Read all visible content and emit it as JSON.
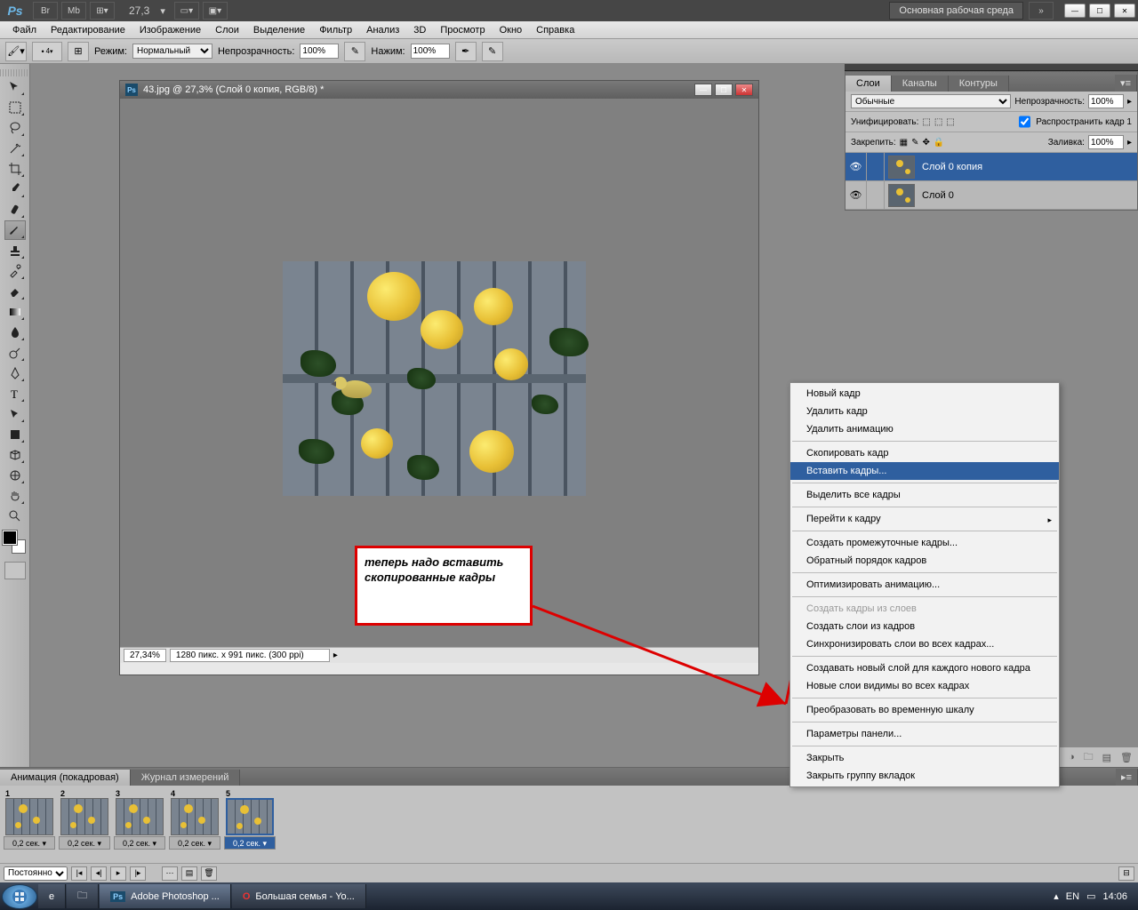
{
  "titlebar": {
    "zoom": "27,3",
    "workspace": "Основная рабочая среда"
  },
  "menu": [
    "Файл",
    "Редактирование",
    "Изображение",
    "Слои",
    "Выделение",
    "Фильтр",
    "Анализ",
    "3D",
    "Просмотр",
    "Окно",
    "Справка"
  ],
  "options": {
    "brush_size": "4",
    "mode_label": "Режим:",
    "mode": "Нормальный",
    "opacity_label": "Непрозрачность:",
    "opacity": "100%",
    "flow_label": "Нажим:",
    "flow": "100%"
  },
  "doc": {
    "title": "43.jpg @ 27,3% (Слой 0 копия, RGB/8) *",
    "status_zoom": "27,34%",
    "status_dims": "1280 пикс. x 991 пикс. (300 ppi)"
  },
  "annotation": "теперь надо вставить скопированные кадры",
  "layers_panel": {
    "tabs": [
      "Слои",
      "Каналы",
      "Контуры"
    ],
    "blend": "Обычные",
    "opacity_label": "Непрозрачность:",
    "opacity": "100%",
    "unify_label": "Унифицировать:",
    "propagate_label": "Распространить кадр 1",
    "lock_label": "Закрепить:",
    "fill_label": "Заливка:",
    "fill": "100%",
    "layers": [
      {
        "name": "Слой 0 копия",
        "sel": true
      },
      {
        "name": "Слой 0",
        "sel": false
      }
    ]
  },
  "context_menu": [
    {
      "t": "Новый кадр"
    },
    {
      "t": "Удалить кадр"
    },
    {
      "t": "Удалить анимацию"
    },
    {
      "sep": true
    },
    {
      "t": "Скопировать кадр"
    },
    {
      "t": "Вставить кадры...",
      "hl": true
    },
    {
      "sep": true
    },
    {
      "t": "Выделить все кадры"
    },
    {
      "sep": true
    },
    {
      "t": "Перейти к кадру",
      "arrow": true
    },
    {
      "sep": true
    },
    {
      "t": "Создать промежуточные кадры..."
    },
    {
      "t": "Обратный порядок кадров"
    },
    {
      "sep": true
    },
    {
      "t": "Оптимизировать анимацию..."
    },
    {
      "sep": true
    },
    {
      "t": "Создать кадры из слоев",
      "disabled": true
    },
    {
      "t": "Создать слои из кадров"
    },
    {
      "t": "Синхронизировать слои во всех кадрах..."
    },
    {
      "sep": true
    },
    {
      "t": "Создавать новый слой для каждого нового кадра"
    },
    {
      "t": "Новые слои видимы во всех кадрах"
    },
    {
      "sep": true
    },
    {
      "t": "Преобразовать во временную шкалу"
    },
    {
      "sep": true
    },
    {
      "t": "Параметры панели..."
    },
    {
      "sep": true
    },
    {
      "t": "Закрыть"
    },
    {
      "t": "Закрыть группу вкладок"
    }
  ],
  "anim": {
    "tabs": [
      "Анимация (покадровая)",
      "Журнал измерений"
    ],
    "frames": [
      {
        "n": "1",
        "time": "0,2 сек."
      },
      {
        "n": "2",
        "time": "0,2 сек."
      },
      {
        "n": "3",
        "time": "0,2 сек."
      },
      {
        "n": "4",
        "time": "0,2 сек."
      },
      {
        "n": "5",
        "time": "0,2 сек.",
        "sel": true
      }
    ],
    "loop": "Постоянно"
  },
  "taskbar": {
    "items": [
      {
        "icon": "ps",
        "label": "Adobe Photoshop ...",
        "active": true
      },
      {
        "icon": "opera",
        "label": "Большая семья - Yo..."
      }
    ],
    "lang": "EN",
    "time": "14:06"
  }
}
